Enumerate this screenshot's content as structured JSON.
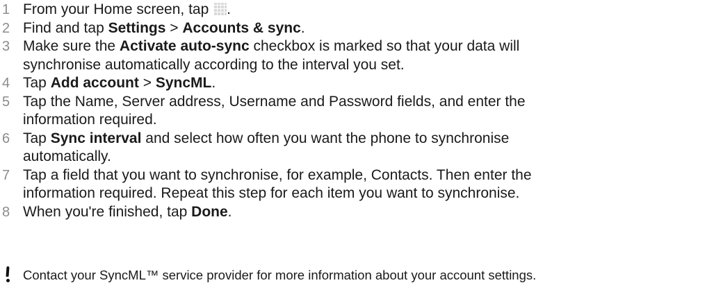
{
  "steps": [
    {
      "num": "1",
      "parts": [
        "From your Home screen, tap ",
        "."
      ]
    },
    {
      "num": "2",
      "parts": [
        "Find and tap ",
        "Settings",
        " > ",
        "Accounts & sync",
        "."
      ]
    },
    {
      "num": "3",
      "lines": [
        [
          "Make sure the ",
          "Activate auto-sync",
          " checkbox is marked so that your data will"
        ],
        [
          "synchronise automatically according to the interval you set."
        ]
      ]
    },
    {
      "num": "4",
      "parts": [
        "Tap ",
        "Add account",
        " > ",
        "SyncML",
        "."
      ]
    },
    {
      "num": "5",
      "lines": [
        [
          "Tap the Name, Server address, Username and Password fields, and enter the"
        ],
        [
          "information required."
        ]
      ]
    },
    {
      "num": "6",
      "lines": [
        [
          "Tap ",
          "Sync interval",
          " and select how often you want the phone to synchronise"
        ],
        [
          "automatically."
        ]
      ]
    },
    {
      "num": "7",
      "lines": [
        [
          "Tap a field that you want to synchronise, for example, Contacts. Then enter the"
        ],
        [
          "information required. Repeat this step for each item you want to synchronise."
        ]
      ]
    },
    {
      "num": "8",
      "parts": [
        "When you're finished, tap ",
        "Done",
        "."
      ]
    }
  ],
  "note": {
    "icon": "exclamation-icon",
    "text": "Contact your SyncML™ service provider for more information about your account settings."
  }
}
